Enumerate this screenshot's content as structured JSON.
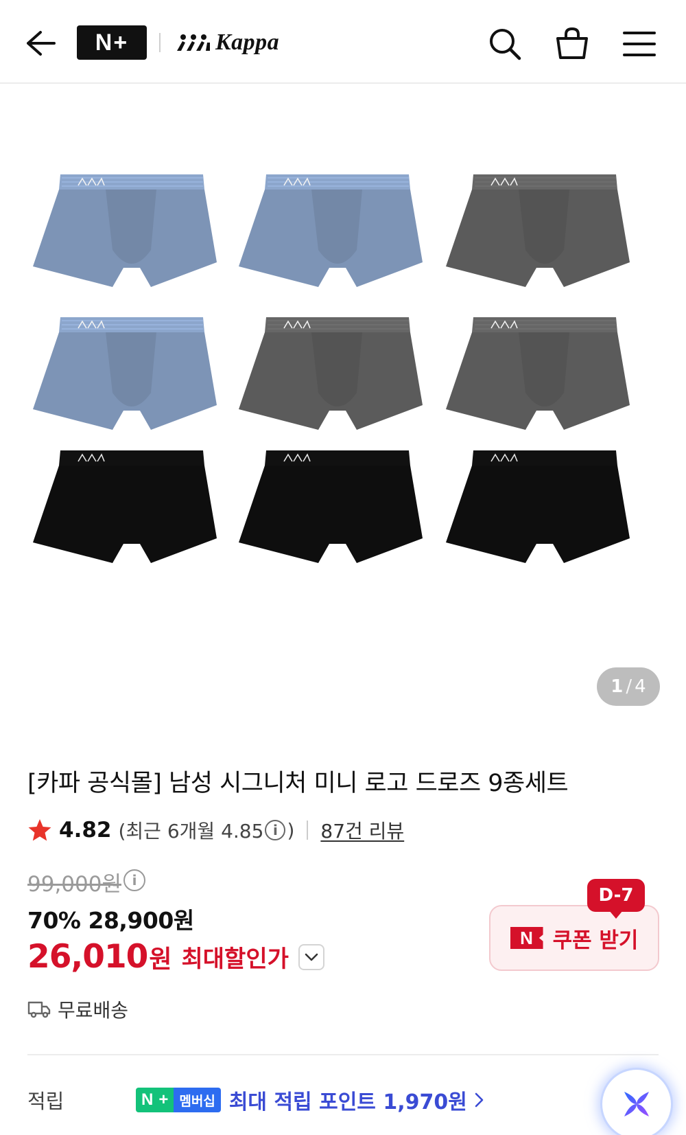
{
  "header": {
    "back_icon": "arrow-left-icon",
    "store_logo": "N+",
    "brand_name": "Kappa",
    "search_icon": "search-icon",
    "cart_icon": "shopping-bag-icon",
    "menu_icon": "hamburger-menu-icon"
  },
  "gallery": {
    "current_page": "1",
    "separator": "/",
    "total_pages": "4",
    "trunk_colors": [
      "#7d94b6",
      "#7d94b6",
      "#5b5b5b",
      "#7d94b6",
      "#5b5b5b",
      "#5b5b5b",
      "#0e0e0e",
      "#0e0e0e",
      "#0e0e0e"
    ]
  },
  "product": {
    "title": "[카파 공식몰] 남성 시그니처 미니 로고 드로즈 9종세트",
    "rating": "4.82",
    "recent_rating_prefix": "(최근 6개월 4.85",
    "recent_rating_suffix": ")",
    "review_count": "87건 리뷰",
    "original_price": "99,000원",
    "discount_line": "70% 28,900원",
    "max_price": "26,010",
    "max_price_unit": "원",
    "max_discount_label": "최대할인가",
    "shipping": "무료배송"
  },
  "coupon": {
    "badge": "D-7",
    "n_mark": "N",
    "label": "쿠폰 받기"
  },
  "points": {
    "label": "적립",
    "badge_n": "N",
    "badge_plus": "+",
    "badge_membership": "멤버십",
    "text": "최대 적립 포인트 1,970원"
  },
  "colors": {
    "accent_red": "#d5112a",
    "points_blue": "#3a4bd4",
    "membership_green": "#13c27a",
    "membership_blue": "#2d6cf0"
  }
}
